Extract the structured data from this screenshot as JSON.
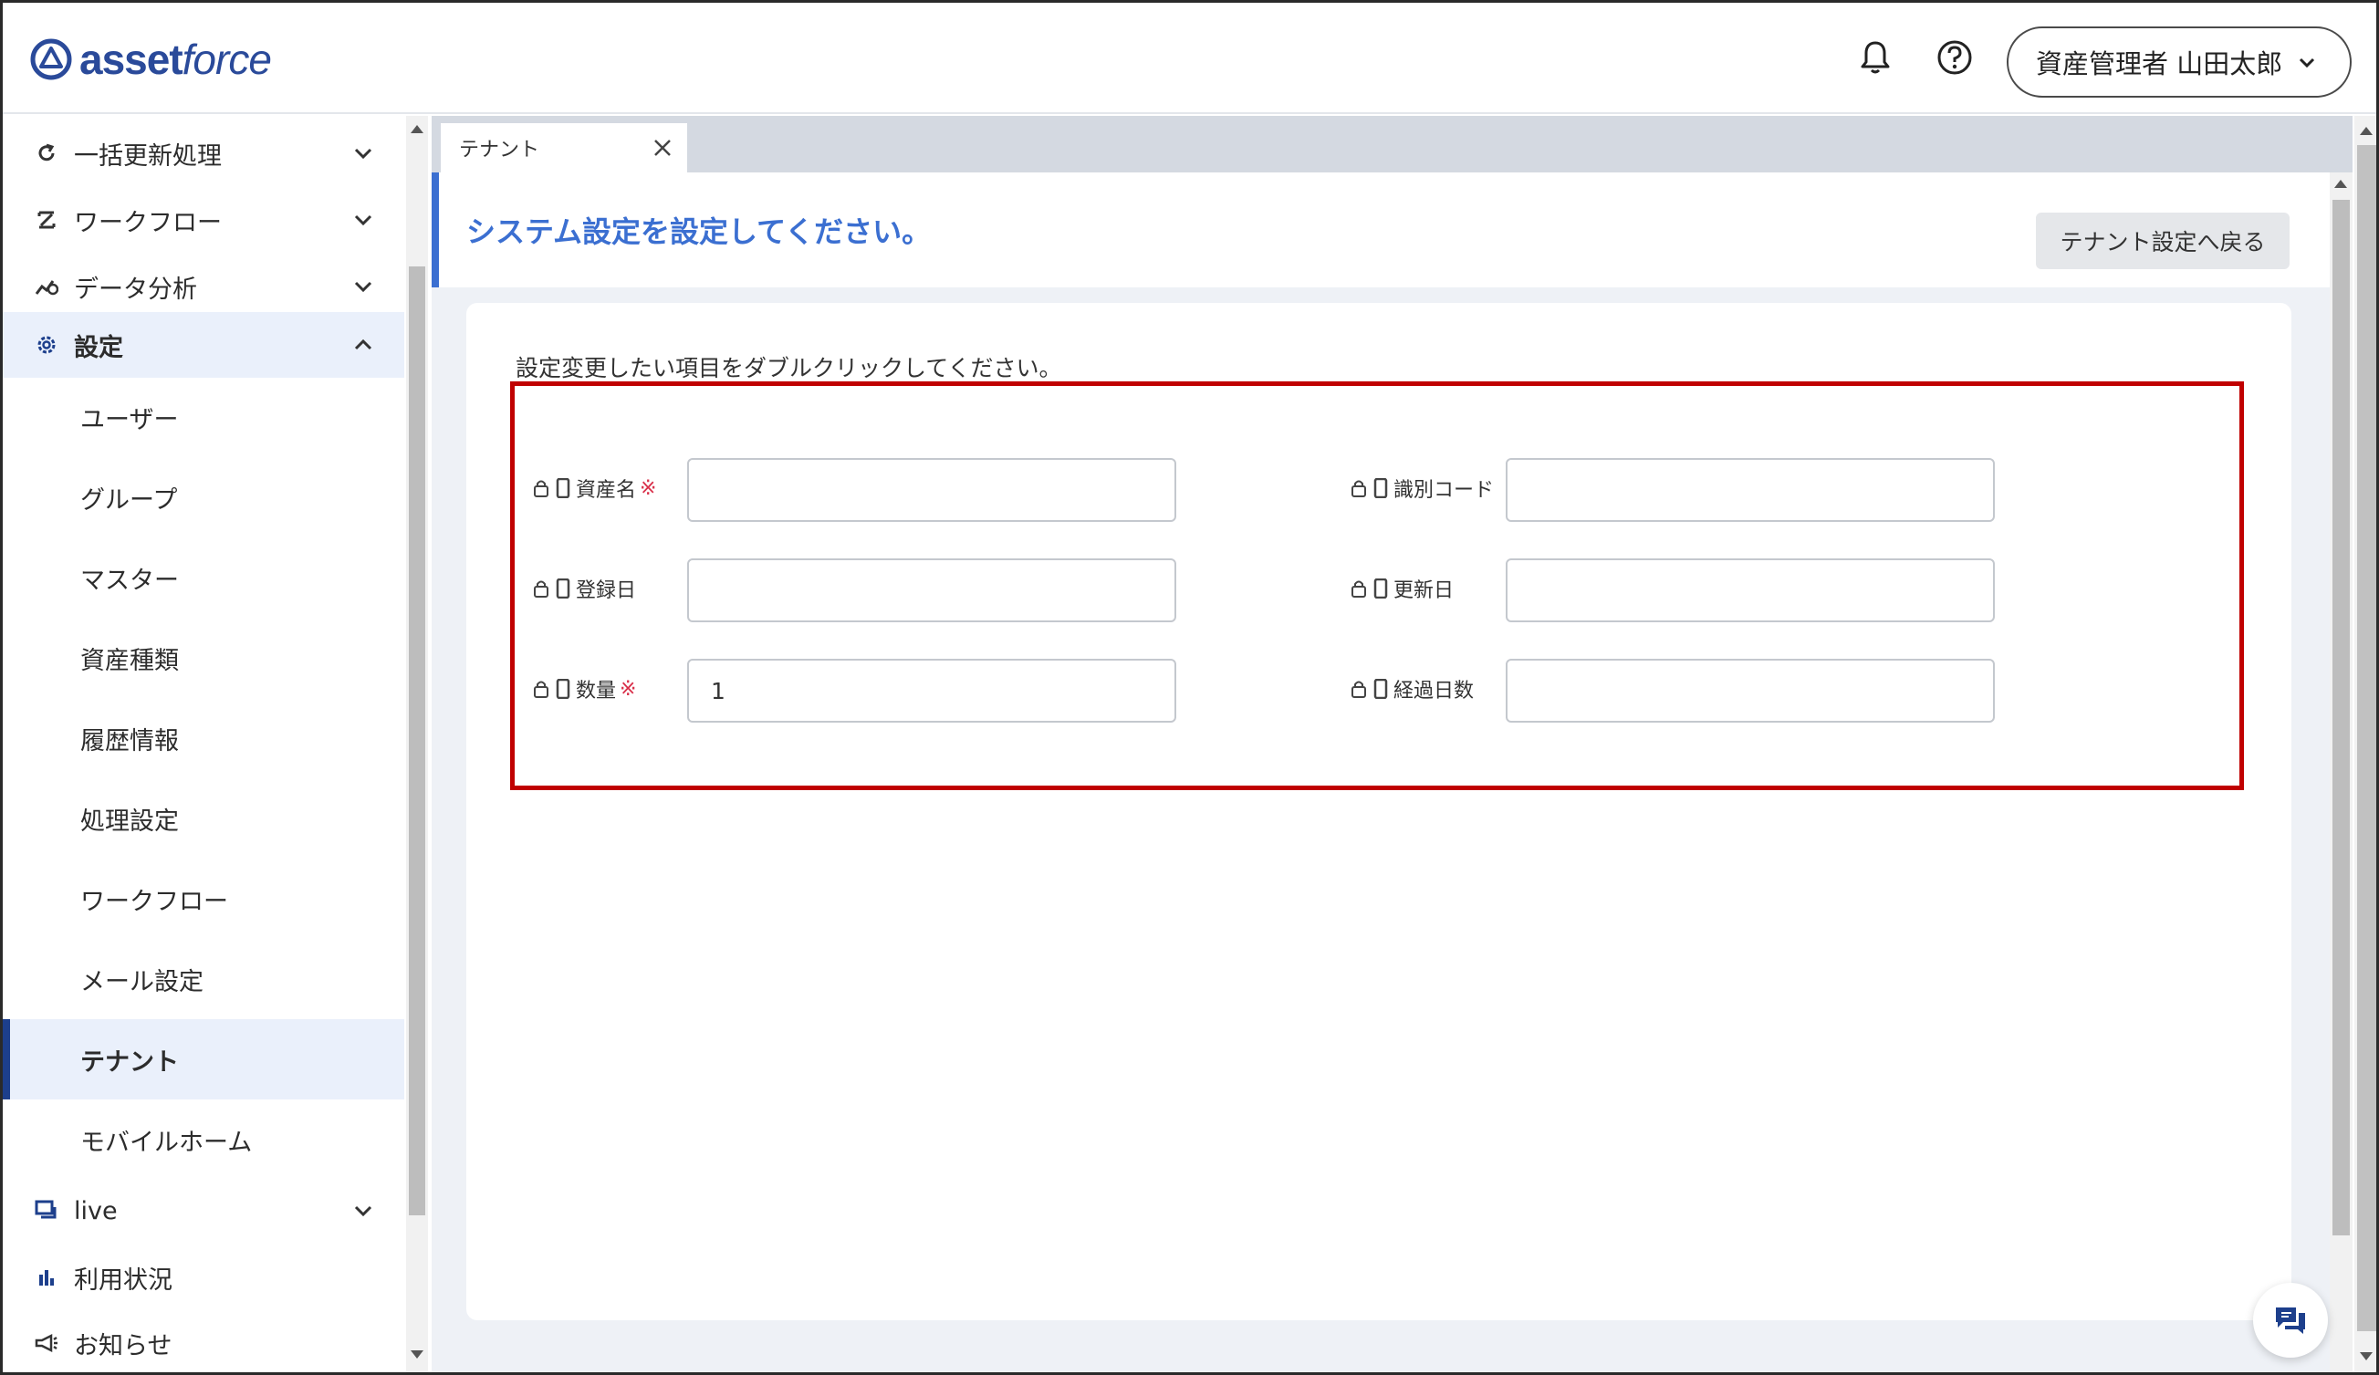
{
  "header": {
    "logo_text_1": "asset",
    "logo_text_2": "force",
    "user_label": "資産管理者 山田太郎"
  },
  "sidebar": {
    "items": [
      {
        "label": "一括更新処理",
        "icon": "refresh-icon"
      },
      {
        "label": "ワークフロー",
        "icon": "workflow-icon"
      },
      {
        "label": "データ分析",
        "icon": "analytics-icon"
      },
      {
        "label": "設定",
        "icon": "gear-icon"
      }
    ],
    "sub_items": [
      {
        "label": "ユーザー"
      },
      {
        "label": "グループ"
      },
      {
        "label": "マスター"
      },
      {
        "label": "資産種類"
      },
      {
        "label": "履歴情報"
      },
      {
        "label": "処理設定"
      },
      {
        "label": "ワークフロー"
      },
      {
        "label": "メール設定"
      },
      {
        "label": "テナント"
      },
      {
        "label": "モバイルホーム"
      }
    ],
    "bottom_items": [
      {
        "label": "live",
        "icon": "live-chat-icon"
      },
      {
        "label": "利用状況",
        "icon": "bar-chart-icon"
      },
      {
        "label": "お知らせ",
        "icon": "megaphone-icon"
      }
    ]
  },
  "tab": {
    "label": "テナント"
  },
  "page": {
    "title": "システム設定を設定してください。",
    "back_button": "テナント設定へ戻る",
    "instruction": "設定変更したい項目をダブルクリックしてください。"
  },
  "fields": [
    {
      "label": "資産名",
      "required": "※",
      "value": ""
    },
    {
      "label": "識別コード",
      "required": "",
      "value": ""
    },
    {
      "label": "登録日",
      "required": "",
      "value": ""
    },
    {
      "label": "更新日",
      "required": "",
      "value": ""
    },
    {
      "label": "数量",
      "required": "※",
      "value": "1"
    },
    {
      "label": "経過日数",
      "required": "",
      "value": ""
    }
  ],
  "colors": {
    "brand": "#2a4a9a",
    "accent": "#3b6fd1",
    "highlight_border": "#c00000",
    "active_bar": "#1d3f8c"
  }
}
